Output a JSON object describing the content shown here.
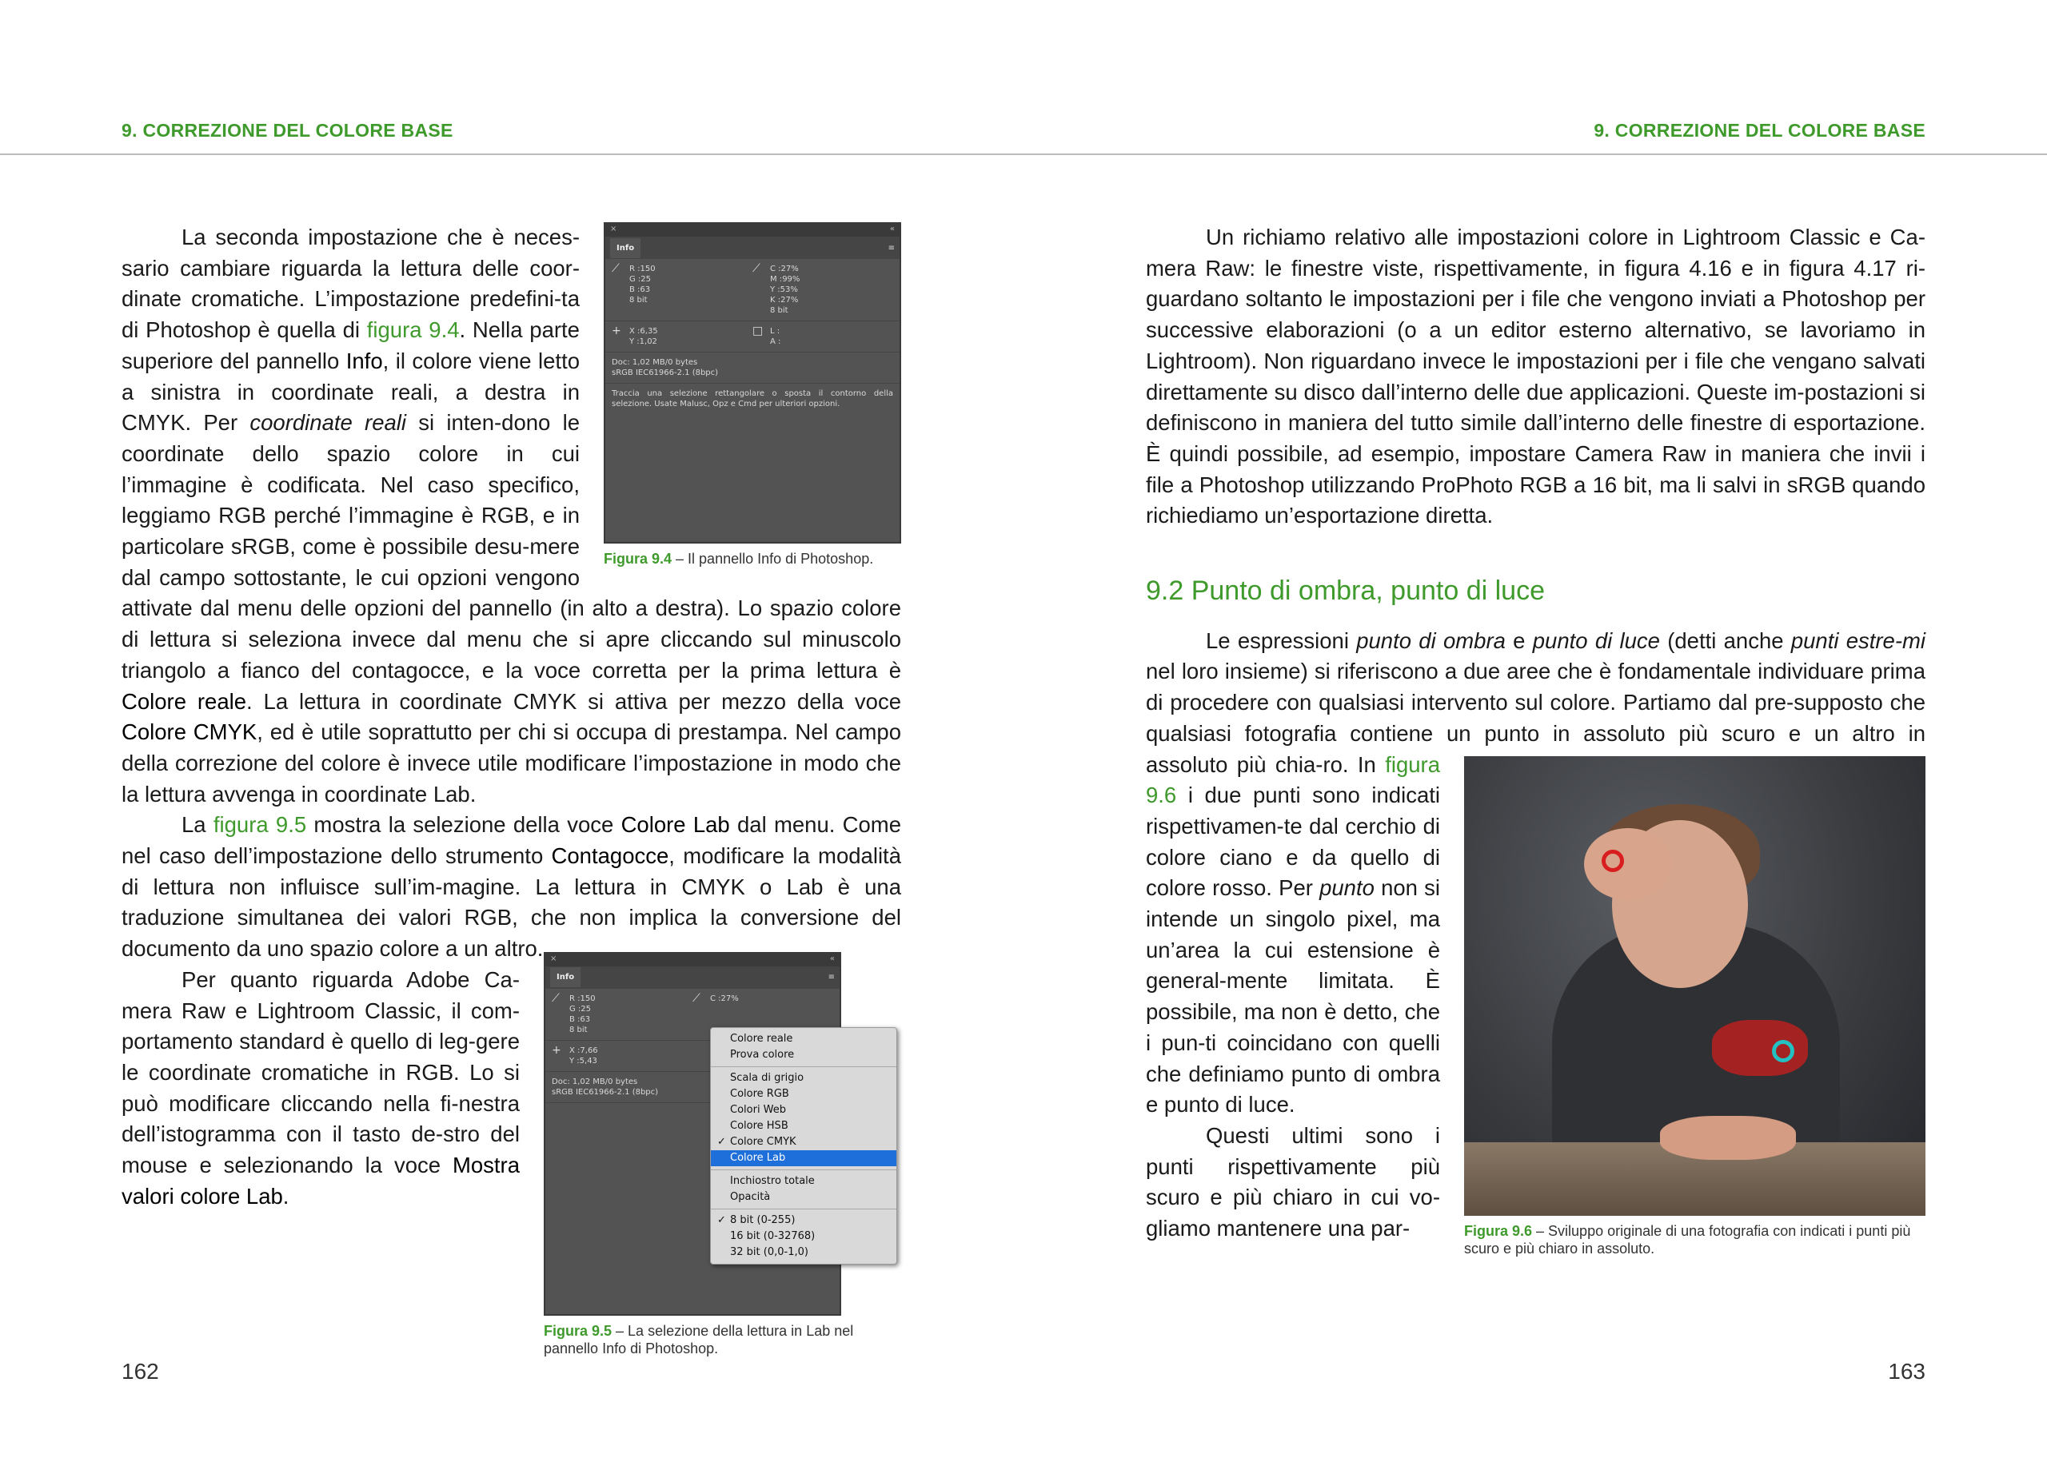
{
  "header": {
    "left": "9. CORREZIONE DEL COLORE BASE",
    "right": "9. CORREZIONE DEL COLORE BASE"
  },
  "page_numbers": {
    "left": "162",
    "right": "163"
  },
  "left_page": {
    "p1_a": "La seconda impostazione che è neces-sario cambiare riguarda la lettura delle coor-dinate cromatiche. L’impostazione predefini-ta di Photoshop è quella di ",
    "p1_fig94": "figura 9.4",
    "p1_b": ". Nella parte superiore del pannello ",
    "p1_info": "Info",
    "p1_c": ", il colore viene letto a sinistra in coordinate reali, a destra in CMYK. Per ",
    "p1_coord": "coordinate reali",
    "p1_d": " si inten-dono le coordinate dello spazio colore in cui l’immagine è codificata. Nel caso specifico, leggiamo RGB perché l’immagine è RGB, e in particolare sRGB, come è possibile desu-mere dal campo sottostante, le cui opzioni vengono attivate dal menu delle opzioni del pannello (in alto a destra). Lo spazio colore di lettura si seleziona invece dal menu che si apre cliccando sul minuscolo triangolo a fianco del contagocce, e la voce corretta per la prima lettura è ",
    "p1_reale": "Colore reale",
    "p1_e": ". La lettura in coordinate CMYK si attiva per mezzo della voce ",
    "p1_cmyk": "Colore CMYK",
    "p1_f": ", ed è utile soprattutto per chi si occupa di prestampa. Nel campo della correzione del colore è invece utile modificare l’impostazione in modo che la lettura avvenga in coordinate Lab.",
    "p2_a": "La ",
    "p2_fig95": "figura 9.5",
    "p2_b": " mostra la selezione della voce ",
    "p2_lab": "Colore Lab",
    "p2_c": " dal menu. Come nel caso dell’impostazione dello strumento ",
    "p2_conta": "Contagocce",
    "p2_d": ", modificare la modalità di lettura non influisce sull’im-magine. La lettura in CMYK o Lab è una traduzione simultanea dei valori RGB, che non implica la conversione del documento da uno spazio colore a un altro.",
    "p3_a": "Per quanto riguarda Adobe Ca-mera Raw e Lightroom Classic, il com-portamento standard è quello di leg-gere le coordinate cromatiche in RGB. Lo si può modificare cliccando nella fi-nestra dell’istogramma con il tasto de-stro del mouse e selezionando la voce ",
    "p3_mostra": "Mostra valori colore Lab",
    "p3_b": "."
  },
  "fig94": {
    "label": "Figura 9.4",
    "caption": " – Il pannello Info di Photoshop."
  },
  "fig95": {
    "label": "Figura 9.5",
    "caption": " – La selezione della lettura in Lab nel pannello Info di Photoshop."
  },
  "fig96": {
    "label": "Figura 9.6",
    "caption": " – Sviluppo originale di una fotografia con indicati i punti più scuro e più chiaro in assoluto."
  },
  "panel": {
    "close": "×",
    "collapse": "«",
    "tab": "Info",
    "menu_icon": "≡",
    "R": "R :",
    "G": "G :",
    "B": "B :",
    "R_val": "150",
    "G_val": "25",
    "B_val": "63",
    "C": "C :",
    "M": "M :",
    "Y": "Y :",
    "K": "K :",
    "C_val": "27%",
    "M_val": "99%",
    "Y_val": "53%",
    "K_val": "27%",
    "bit": "8 bit",
    "X": "X :",
    "Y2": "Y :",
    "X_val": "6,35",
    "Y2_val": "1,02",
    "X_val2": "7,66",
    "Y2_val2": "5,43",
    "L": "L :",
    "A": "A :",
    "doc": "Doc: 1,02 MB/0 bytes",
    "profile": "sRGB IEC61966-2.1 (8bpc)",
    "hint": "Traccia una selezione rettangolare o sposta il contorno della selezione. Usate Malusc, Opz e Cmd per ulteriori opzioni."
  },
  "menu": {
    "items1": [
      "Colore reale",
      "Prova colore"
    ],
    "items2": [
      "Scala di grigio",
      "Colore RGB",
      "Colori Web",
      "Colore HSB"
    ],
    "checked_cmyk": "Colore CMYK",
    "selected": "Colore Lab",
    "items3": [
      "Inchiostro totale",
      "Opacità"
    ],
    "bit8": "8 bit (0-255)",
    "bit16": "16 bit (0-32768)",
    "bit32": "32 bit (0,0-1,0)",
    "check": "✓"
  },
  "right_page": {
    "p1": "Un richiamo relativo alle impostazioni colore in Lightroom Classic e Ca-mera Raw: le finestre viste, rispettivamente, in figura 4.16 e in figura 4.17 ri-guardano soltanto le impostazioni per i file che vengono inviati a Photoshop per successive elaborazioni (o a un editor esterno alternativo, se lavoriamo in Lightroom). Non riguardano invece le impostazioni per i file che vengano salvati direttamente su disco dall’interno delle due applicazioni. Queste im-postazioni si definiscono in maniera del tutto simile dall’interno delle finestre di esportazione. È quindi possibile, ad esempio, impostare Camera Raw in maniera che invii i file a Photoshop utilizzando ProPhoto RGB a 16 bit, ma li salvi in sRGB quando richiediamo un’esportazione diretta.",
    "heading": "9.2 Punto di ombra, punto di luce",
    "p2_a": "Le espressioni ",
    "p2_ombra": "punto di ombra",
    "p2_b": " e ",
    "p2_luce": "punto di luce",
    "p2_c": " (detti anche ",
    "p2_estremi": "punti estre-mi",
    "p2_d": " nel loro insieme) si riferiscono a due aree che è fondamentale individuare prima di procedere con qualsiasi intervento sul colore. Partiamo dal pre-supposto che qualsiasi fotografia contiene un punto in assoluto più scuro e un altro in assoluto più chia-ro. In ",
    "p2_fig96": "figura 9.6",
    "p2_e": " i due punti sono indicati rispettivamen-te dal cerchio di colore ciano e da quello di colore rosso. Per ",
    "p2_punto": "punto",
    "p2_f": " non si intende un singolo pixel, ma un’area la cui estensione è general-mente limitata. È possibile, ma non è detto, che i pun-ti coincidano con quelli che definiamo punto di ombra e punto di luce.",
    "p3": "Questi ultimi sono i punti rispettivamente più scuro e più chiaro in cui vo-gliamo mantenere una par-"
  }
}
